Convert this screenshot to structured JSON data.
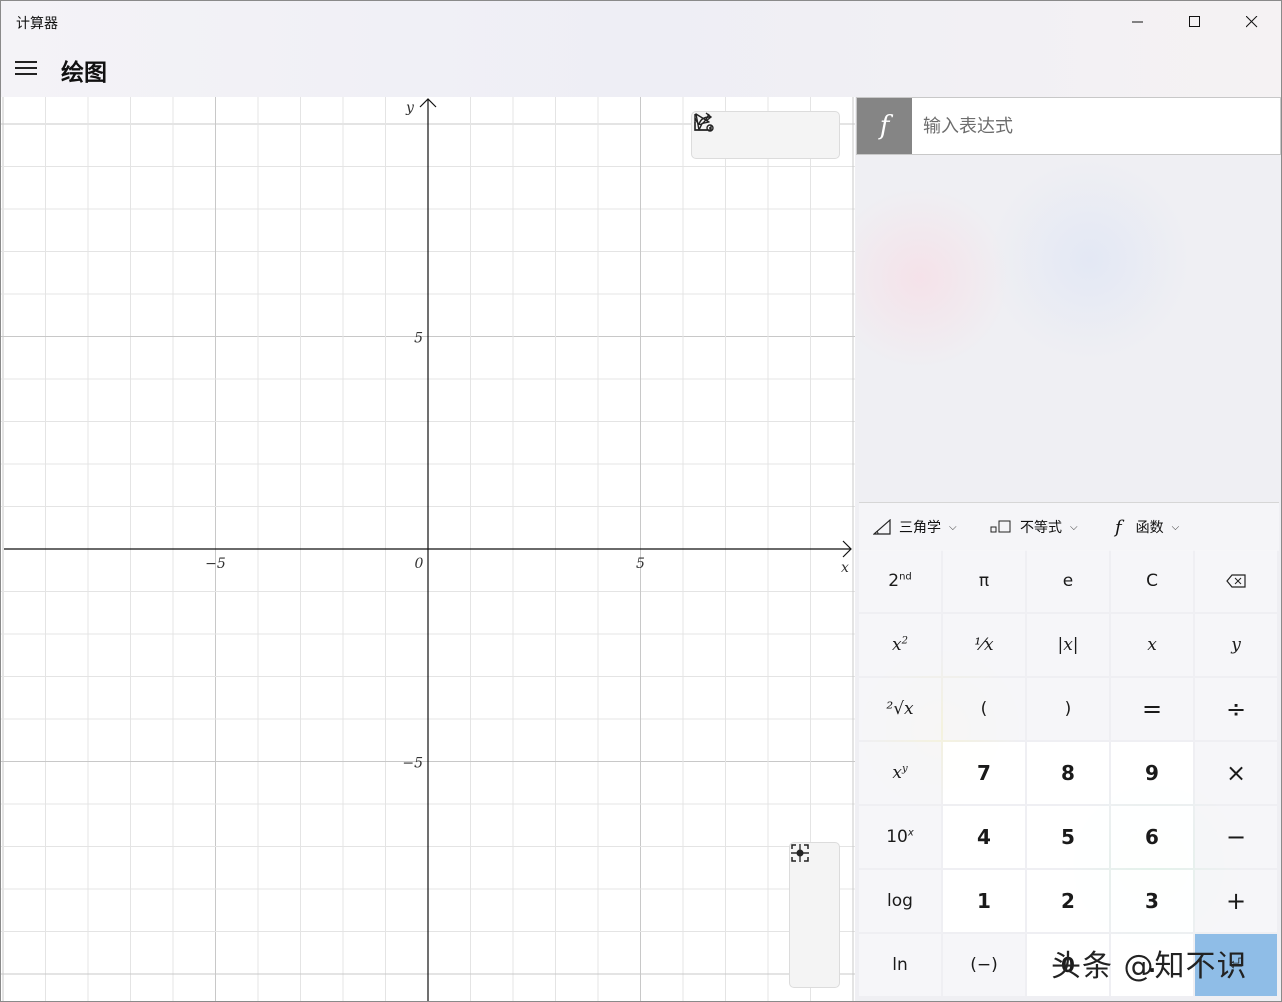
{
  "window": {
    "app_title": "计算器"
  },
  "header": {
    "page_title": "绘图"
  },
  "graph": {
    "x_axis_label": "x",
    "y_axis_label": "y",
    "origin_label": "0",
    "x_tick_labels": [
      {
        "value": -5,
        "text": "−5"
      },
      {
        "value": 5,
        "text": "5"
      }
    ],
    "y_tick_labels": [
      {
        "value": 5,
        "text": "5"
      },
      {
        "value": -5,
        "text": "−5"
      }
    ],
    "x_range": [
      -10,
      10
    ],
    "y_range": [
      -10,
      10
    ],
    "grid": true
  },
  "expression": {
    "prefix": "f",
    "placeholder": "输入表达式"
  },
  "keyboard_tabs": [
    {
      "label": "三角学",
      "icon": "triangle-icon"
    },
    {
      "label": "不等式",
      "icon": "inequality-icon"
    },
    {
      "label": "函数",
      "icon": "function-icon"
    }
  ],
  "keys": [
    [
      "2nd",
      "π",
      "e",
      "C",
      "⌫"
    ],
    [
      "x²",
      "¹⁄x",
      "|x|",
      "x",
      "y"
    ],
    [
      "²√x",
      "(",
      ")",
      "=",
      "÷"
    ],
    [
      "xʸ",
      "7",
      "8",
      "9",
      "×"
    ],
    [
      "10ˣ",
      "4",
      "5",
      "6",
      "−"
    ],
    [
      "log",
      "1",
      "2",
      "3",
      "+"
    ],
    [
      "ln",
      "(−)",
      "0",
      ".",
      "⏎"
    ]
  ],
  "watermark": "头条 @知不识"
}
